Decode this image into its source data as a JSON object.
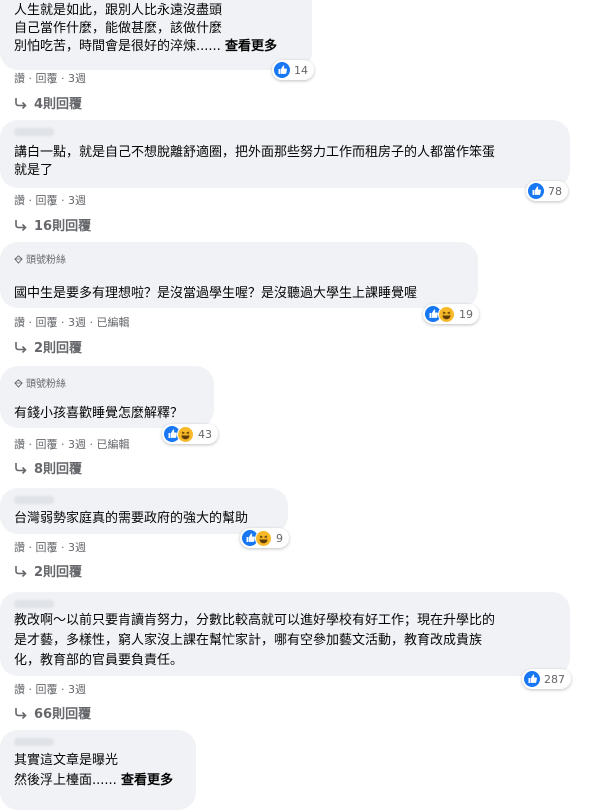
{
  "comments": [
    {
      "badge": "",
      "lines": [
        "人生就是如此，跟別人比永遠沒盡頭",
        "自己當作什麼，能做甚麼，該做什麼",
        "別怕吃苦，時間會是很好的淬煉......"
      ],
      "see_more": "查看更多",
      "reactions": {
        "types": [
          "like"
        ],
        "count": "14"
      },
      "actions": "讚 · 回覆 · 3週",
      "replies": "4則回覆"
    },
    {
      "badge": "",
      "lines": [
        "講白一點，就是自己不想脫離舒適圈，把外面那些努力工作而租房子的人都當作笨蛋",
        "就是了"
      ],
      "see_more": "",
      "reactions": {
        "types": [
          "like"
        ],
        "count": "78"
      },
      "actions": "讚 · 回覆 · 3週",
      "replies": "16則回覆"
    },
    {
      "badge": "頭號粉絲",
      "lines": [
        "國中生是要多有理想啦？是沒當過學生喔？是沒聽過大學生上課睡覺喔"
      ],
      "see_more": "",
      "reactions": {
        "types": [
          "like",
          "haha"
        ],
        "count": "19"
      },
      "actions": "讚 · 回覆 · 3週 · 已編輯",
      "replies": "2則回覆"
    },
    {
      "badge": "頭號粉絲",
      "lines": [
        "有錢小孩喜歡睡覺怎麼解釋？"
      ],
      "see_more": "",
      "reactions": {
        "types": [
          "like",
          "haha"
        ],
        "count": "43"
      },
      "actions": "讚 · 回覆 · 3週 · 已編輯",
      "replies": "8則回覆"
    },
    {
      "badge": "",
      "lines": [
        "台灣弱勢家庭真的需要政府的強大的幫助"
      ],
      "see_more": "",
      "reactions": {
        "types": [
          "like",
          "haha"
        ],
        "count": "9"
      },
      "actions": "讚 · 回覆 · 3週",
      "replies": "2則回覆"
    },
    {
      "badge": "",
      "lines": [
        "教改啊～以前只要肯讀肯努力，分數比較高就可以進好學校有好工作；現在升學比的",
        "是才藝，多樣性，窮人家沒上課在幫忙家計，哪有空參加藝文活動，教育改成貴族",
        "化，教育部的官員要負責任。"
      ],
      "see_more": "",
      "reactions": {
        "types": [
          "like"
        ],
        "count": "287"
      },
      "actions": "讚 · 回覆 · 3週",
      "replies": "66則回覆"
    },
    {
      "badge": "",
      "lines": [
        "其實這文章是曝光",
        "然後浮上檯面......"
      ],
      "see_more": "查看更多",
      "reactions": null,
      "actions": "",
      "replies": ""
    }
  ]
}
